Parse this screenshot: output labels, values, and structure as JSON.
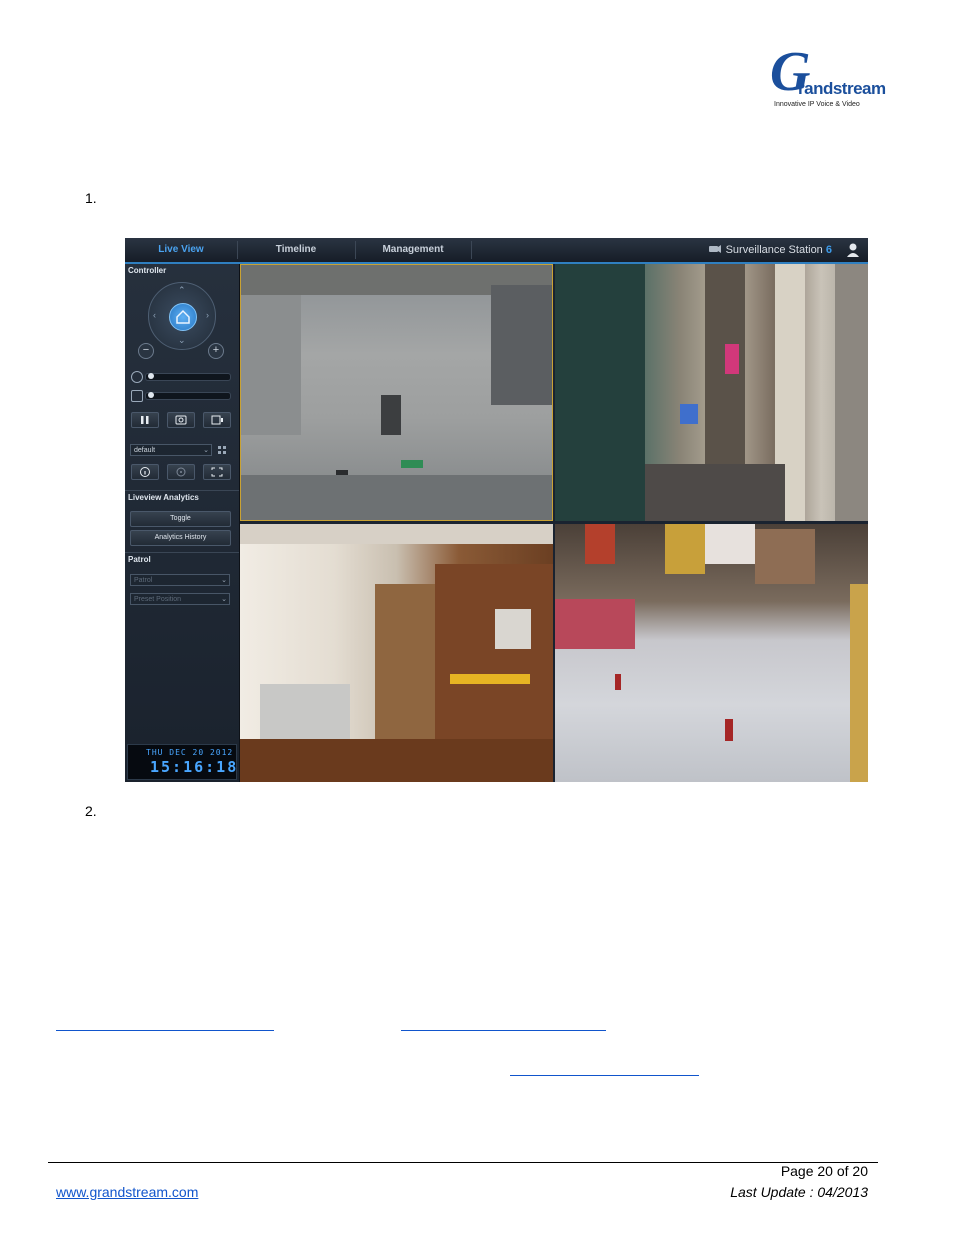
{
  "logo": {
    "letter": "G",
    "wordmark": "randstream",
    "tagline": "Innovative IP Voice & Video"
  },
  "list": {
    "item1": "1.",
    "item2": "2."
  },
  "app": {
    "tabs": [
      {
        "label": "Live View"
      },
      {
        "label": "Timeline"
      },
      {
        "label": "Management"
      }
    ],
    "brand_name": "Surveillance Station",
    "brand_version": "6",
    "accent_color": "#3d9be9",
    "sidebar": {
      "controller_title": "Controller",
      "preset_value": "default",
      "analytics_title": "Liveview Analytics",
      "toggle_label": "Toggle",
      "history_label": "Analytics History",
      "patrol_title": "Patrol",
      "patrol_placeholder": "Patrol",
      "preset_position_placeholder": "Preset Position"
    },
    "clock": {
      "date": "THU DEC 20 2012",
      "time": "15:16:18"
    }
  },
  "footer": {
    "page": "Page 20 of 20",
    "website": "www.grandstream.com",
    "last_update": "Last Update : 04/2013"
  }
}
